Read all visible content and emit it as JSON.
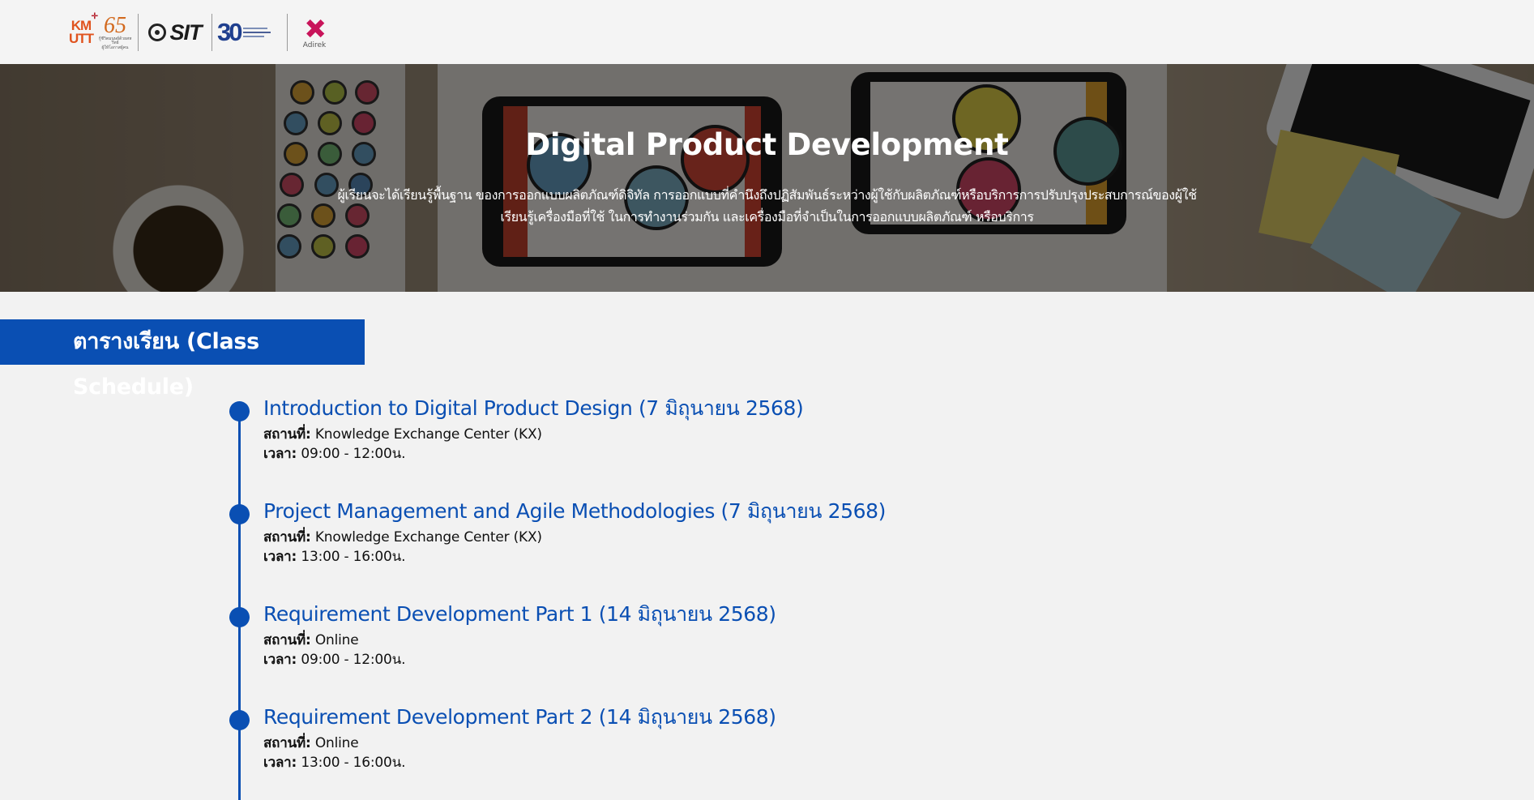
{
  "header": {
    "logos": [
      {
        "name": "kmutt-logo",
        "text": "KMUTT"
      },
      {
        "name": "kmutt-65-years-logo",
        "text": "65"
      },
      {
        "name": "sit-logo",
        "text": "SIT"
      },
      {
        "name": "sit-30-years-logo",
        "text": "30"
      },
      {
        "name": "adirek-logo",
        "text": "Adirek"
      }
    ]
  },
  "hero": {
    "title": "Digital Product Development",
    "description_line1": "ผู้เรียนจะได้เรียนรู้พื้นฐาน ของการออกแบบผลิตภัณฑ์ดิจิทัล การออกแบบที่คำนึงถึงปฏิสัมพันธ์ระหว่างผู้ใช้กับผลิตภัณฑ์หรือบริการการปรับปรุงประสบการณ์ของผู้ใช้",
    "description_line2": "เรียนรู้เครื่องมือที่ใช้ ในการทำงานร่วมกัน และเครื่องมือที่จำเป็นในการออกแบบผลิตภัณฑ์ หรือบริการ"
  },
  "schedule": {
    "heading": "ตารางเรียน (Class Schedule)",
    "location_label": "สถานที่:",
    "time_label": "เวลา:",
    "items": [
      {
        "title": "Introduction to Digital Product Design (7 มิถุนายน 2568)",
        "location": "Knowledge Exchange Center (KX)",
        "time": "09:00 - 12:00น."
      },
      {
        "title": "Project Management and Agile Methodologies (7 มิถุนายน 2568)",
        "location": "Knowledge Exchange Center (KX)",
        "time": "13:00 - 16:00น."
      },
      {
        "title": "Requirement Development Part 1 (14 มิถุนายน 2568)",
        "location": "Online",
        "time": "09:00 - 12:00น."
      },
      {
        "title": "Requirement Development Part 2 (14 มิถุนายน 2568)",
        "location": "Online",
        "time": "13:00 - 16:00น."
      }
    ]
  },
  "colors": {
    "accent": "#0a4fb3",
    "background": "#f2f2f2"
  }
}
